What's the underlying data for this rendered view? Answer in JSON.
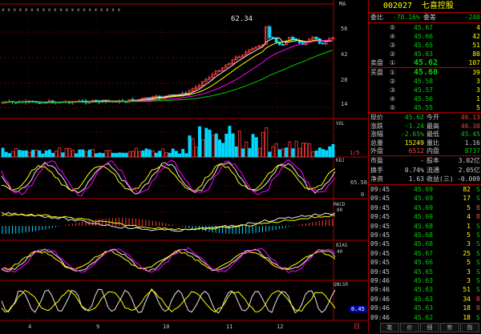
{
  "colors": {
    "up": "#ff3c3c",
    "down": "#00d8ff",
    "white": "#e8e8e8",
    "yellow": "#ffff00",
    "magenta": "#ff00ff",
    "green": "#00d000",
    "frame": "#b00000"
  },
  "stock": {
    "code": "002027",
    "name": "七喜控股"
  },
  "chart": {
    "top_marks": "x  x  x              x  x x x x x   x  x x x     x     x x x x x  x  x",
    "ma_label": "MA",
    "high_label": "62.34",
    "price_axis": [
      "56",
      "42",
      "28",
      "14"
    ],
    "x_axis": [
      "4",
      "9",
      "10",
      "11",
      "12"
    ],
    "vol_label": "VOL",
    "vol_scale": "1/5",
    "kdj_label": "KDJ",
    "kdj_values": [
      "65.56",
      "0"
    ],
    "macd_label": "MACD",
    "bias_label": "BIAS",
    "qnlsr_label": "QNLSR",
    "qnlsr_value": "0.45",
    "corner_label": "日",
    "indicators_misc": [
      "80",
      "40"
    ]
  },
  "side": {
    "wb_label": "委比",
    "wb_value": "-70.16%",
    "wc_label": "委差",
    "wc_value": "-240",
    "sell": [
      {
        "lvl": "⑤",
        "price": "45.67",
        "vol": "4"
      },
      {
        "lvl": "④",
        "price": "45.66",
        "vol": "42"
      },
      {
        "lvl": "③",
        "price": "45.65",
        "vol": "51"
      },
      {
        "lvl": "②",
        "price": "45.63",
        "vh": "80",
        "vol": "80"
      },
      {
        "lvl": "①",
        "price": "45.62",
        "vol": "107"
      }
    ],
    "sell_label": "卖盘",
    "buy_label": "买盘",
    "buy": [
      {
        "lvl": "①",
        "price": "45.60",
        "vol": "39"
      },
      {
        "lvl": "②",
        "price": "45.58",
        "vol": "3"
      },
      {
        "lvl": "③",
        "price": "45.57",
        "vol": "3"
      },
      {
        "lvl": "④",
        "price": "45.56",
        "vol": "1"
      },
      {
        "lvl": "⑤",
        "price": "45.55",
        "vol": "5"
      }
    ],
    "quote": [
      {
        "l1": "现价",
        "v1": "45.62",
        "l2": "今开",
        "v2": "46.13"
      },
      {
        "l1": "涨跌",
        "v1": "-1.24",
        "l2": "最高",
        "v2": "46.30"
      },
      {
        "l1": "涨幅",
        "v1": "-2.65%",
        "l2": "最低",
        "v2": "45.45"
      },
      {
        "l1": "总量",
        "v1": "15249",
        "l2": "量比",
        "v2": "1.16"
      },
      {
        "l1": "外盘",
        "v1": "6512",
        "l2": "内盘",
        "v2": "8737"
      }
    ],
    "fin": [
      {
        "l1": "市盈",
        "v1": "-",
        "l2": "股本",
        "v2": "3.02亿"
      },
      {
        "l1": "换手",
        "v1": "0.74%",
        "l2": "流通",
        "v2": "2.05亿"
      },
      {
        "l1": "净资",
        "v1": "1.63",
        "l2": "收益(三)",
        "v2": "-0.009"
      }
    ],
    "ticks": [
      {
        "t": "09:45",
        "p": "45.69",
        "v": "82",
        "s": "S"
      },
      {
        "t": "09:45",
        "p": "45.69",
        "v": "17",
        "s": "S"
      },
      {
        "t": "09:45",
        "p": "45.69",
        "v": "5",
        "s": "B"
      },
      {
        "t": "09:45",
        "p": "45.69",
        "v": "4",
        "s": "B"
      },
      {
        "t": "09:45",
        "p": "45.68",
        "v": "1",
        "s": "S"
      },
      {
        "t": "09:45",
        "p": "45.68",
        "v": "5",
        "s": "S"
      },
      {
        "t": "09:45",
        "p": "45.68",
        "v": "3",
        "s": "S"
      },
      {
        "t": "09:45",
        "p": "45.67",
        "v": "25",
        "s": "S"
      },
      {
        "t": "09:45",
        "p": "45.66",
        "v": "5",
        "s": "S"
      },
      {
        "t": "09:45",
        "p": "45.65",
        "v": "3",
        "s": "S"
      },
      {
        "t": "09:46",
        "p": "45.63",
        "v": "3",
        "s": "S"
      },
      {
        "t": "09:46",
        "p": "45.63",
        "v": "51",
        "s": "S"
      },
      {
        "t": "09:46",
        "p": "45.63",
        "v": "34",
        "s": "B"
      },
      {
        "t": "09:46",
        "p": "45.63",
        "v": "18",
        "s": "B"
      },
      {
        "t": "09:46",
        "p": "45.62",
        "v": "18",
        "s": "S"
      }
    ],
    "tabs": [
      "笔",
      "价",
      "细",
      "势",
      "指"
    ]
  }
}
